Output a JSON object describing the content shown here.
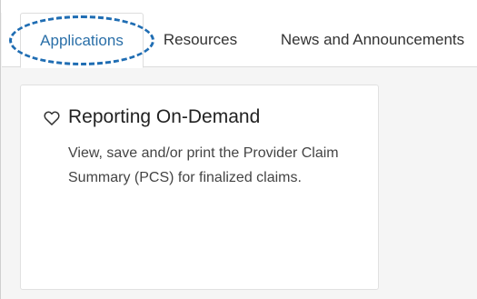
{
  "tabs": [
    {
      "label": "Applications",
      "active": true
    },
    {
      "label": "Resources",
      "active": false
    },
    {
      "label": "News and Announcements",
      "active": false
    }
  ],
  "card": {
    "favorite_icon": "heart-outline-icon",
    "title": "Reporting On-Demand",
    "description": "View, save and/or print the Provider Claim Summary (PCS) for finalized claims."
  },
  "colors": {
    "accent": "#2a6fa8",
    "highlight": "#1f6db3",
    "background": "#f5f5f5"
  }
}
